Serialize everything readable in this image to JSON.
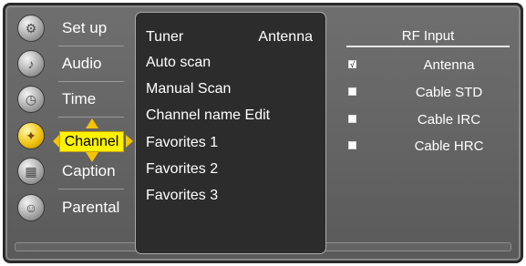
{
  "sidebar": {
    "items": [
      {
        "label": "Set up",
        "icon": "setup-icon"
      },
      {
        "label": "Audio",
        "icon": "audio-icon"
      },
      {
        "label": "Time",
        "icon": "clock-icon"
      },
      {
        "label": "Channel",
        "icon": "satellite-icon"
      },
      {
        "label": "Caption",
        "icon": "caption-icon"
      },
      {
        "label": "Parental",
        "icon": "parental-icon"
      }
    ],
    "selected": "Channel",
    "highlight_color": "#fff200"
  },
  "channel_menu": {
    "items": [
      {
        "label": "Tuner",
        "value": "Antenna"
      },
      {
        "label": "Auto scan"
      },
      {
        "label": "Manual Scan"
      },
      {
        "label": "Channel name Edit"
      },
      {
        "label": "Favorites 1"
      },
      {
        "label": "Favorites 2"
      },
      {
        "label": "Favorites 3"
      }
    ]
  },
  "rf_input": {
    "title": "RF Input",
    "check_mark": "√",
    "options": [
      {
        "label": "Antenna",
        "checked": true
      },
      {
        "label": "Cable STD",
        "checked": false
      },
      {
        "label": "Cable IRC",
        "checked": false
      },
      {
        "label": "Cable HRC",
        "checked": false
      }
    ]
  }
}
